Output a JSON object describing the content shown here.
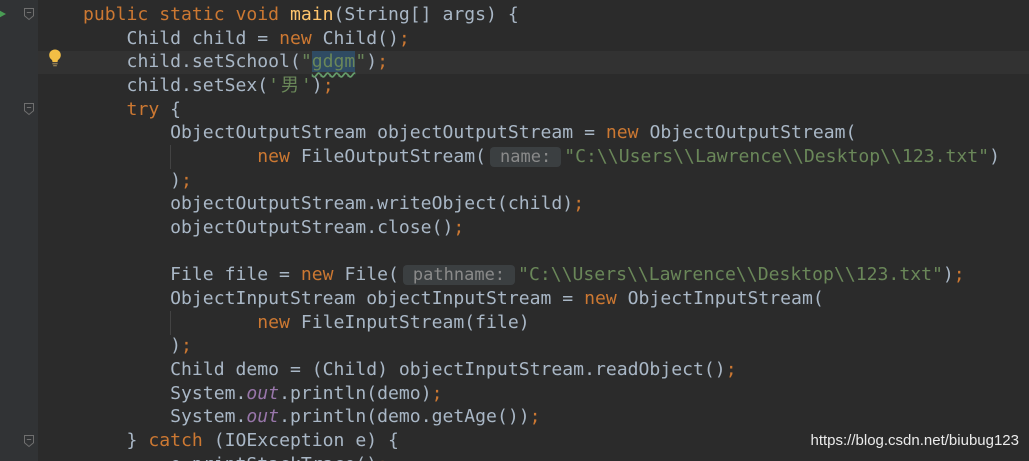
{
  "editor": {
    "lines": [
      {
        "indent": 4,
        "tokens": [
          {
            "type": "keyword",
            "text": "public static void "
          },
          {
            "type": "method-declaration",
            "text": "main"
          },
          {
            "type": "plain",
            "text": "(String[] args) {"
          }
        ]
      },
      {
        "indent": 8,
        "tokens": [
          {
            "type": "plain",
            "text": "Child child = "
          },
          {
            "type": "keyword",
            "text": "new"
          },
          {
            "type": "plain",
            "text": " Child()"
          },
          {
            "type": "punctuation",
            "text": ";"
          }
        ]
      },
      {
        "indent": 8,
        "tokens": [
          {
            "type": "plain",
            "text": "child.setSchool("
          },
          {
            "type": "string",
            "text": "\""
          },
          {
            "type": "string",
            "text": "gdgm",
            "typo": true,
            "selected": true
          },
          {
            "type": "string",
            "text": "\""
          },
          {
            "type": "plain",
            "text": ")"
          },
          {
            "type": "punctuation",
            "text": ";"
          }
        ]
      },
      {
        "indent": 8,
        "tokens": [
          {
            "type": "plain",
            "text": "child.setSex("
          },
          {
            "type": "string",
            "text": "'"
          },
          {
            "type": "string",
            "text": "男"
          },
          {
            "type": "string",
            "text": "'"
          },
          {
            "type": "plain",
            "text": ")"
          },
          {
            "type": "punctuation",
            "text": ";"
          }
        ]
      },
      {
        "indent": 8,
        "tokens": [
          {
            "type": "keyword",
            "text": "try"
          },
          {
            "type": "plain",
            "text": " {"
          }
        ]
      },
      {
        "indent": 12,
        "tokens": [
          {
            "type": "plain",
            "text": "ObjectOutputStream objectOutputStream = "
          },
          {
            "type": "keyword",
            "text": "new"
          },
          {
            "type": "plain",
            "text": " ObjectOutputStream("
          }
        ]
      },
      {
        "indent": 20,
        "tokens": [
          {
            "type": "keyword",
            "text": "new"
          },
          {
            "type": "plain",
            "text": " FileOutputStream("
          },
          {
            "type": "param-hint",
            "text": "name:"
          },
          {
            "type": "string",
            "text": "\"C:\\\\Users\\\\Lawrence\\\\Desktop\\\\123.txt\""
          },
          {
            "type": "plain",
            "text": ")"
          }
        ]
      },
      {
        "indent": 12,
        "tokens": [
          {
            "type": "plain",
            "text": ")"
          },
          {
            "type": "punctuation",
            "text": ";"
          }
        ]
      },
      {
        "indent": 12,
        "tokens": [
          {
            "type": "plain",
            "text": "objectOutputStream.writeObject(child)"
          },
          {
            "type": "punctuation",
            "text": ";"
          }
        ]
      },
      {
        "indent": 12,
        "tokens": [
          {
            "type": "plain",
            "text": "objectOutputStream.close()"
          },
          {
            "type": "punctuation",
            "text": ";"
          }
        ]
      },
      {
        "indent": 0,
        "tokens": []
      },
      {
        "indent": 12,
        "tokens": [
          {
            "type": "plain",
            "text": "File file = "
          },
          {
            "type": "keyword",
            "text": "new"
          },
          {
            "type": "plain",
            "text": " File("
          },
          {
            "type": "param-hint",
            "text": "pathname:"
          },
          {
            "type": "string",
            "text": "\"C:\\\\Users\\\\Lawrence\\\\Desktop\\\\123.txt\""
          },
          {
            "type": "plain",
            "text": ")"
          },
          {
            "type": "punctuation",
            "text": ";"
          }
        ]
      },
      {
        "indent": 12,
        "tokens": [
          {
            "type": "plain",
            "text": "ObjectInputStream objectInputStream = "
          },
          {
            "type": "keyword",
            "text": "new"
          },
          {
            "type": "plain",
            "text": " ObjectInputStream("
          }
        ]
      },
      {
        "indent": 20,
        "tokens": [
          {
            "type": "keyword",
            "text": "new"
          },
          {
            "type": "plain",
            "text": " FileInputStream(file)"
          }
        ]
      },
      {
        "indent": 12,
        "tokens": [
          {
            "type": "plain",
            "text": ")"
          },
          {
            "type": "punctuation",
            "text": ";"
          }
        ]
      },
      {
        "indent": 12,
        "tokens": [
          {
            "type": "plain",
            "text": "Child demo = (Child) objectInputStream.readObject()"
          },
          {
            "type": "punctuation",
            "text": ";"
          }
        ]
      },
      {
        "indent": 12,
        "tokens": [
          {
            "type": "plain",
            "text": "System."
          },
          {
            "type": "static-field",
            "text": "out"
          },
          {
            "type": "plain",
            "text": ".println(demo)"
          },
          {
            "type": "punctuation",
            "text": ";"
          }
        ]
      },
      {
        "indent": 12,
        "tokens": [
          {
            "type": "plain",
            "text": "System."
          },
          {
            "type": "static-field",
            "text": "out"
          },
          {
            "type": "plain",
            "text": ".println(demo.getAge())"
          },
          {
            "type": "punctuation",
            "text": ";"
          }
        ]
      },
      {
        "indent": 8,
        "tokens": [
          {
            "type": "plain",
            "text": "} "
          },
          {
            "type": "keyword",
            "text": "catch"
          },
          {
            "type": "plain",
            "text": " (IOException e) {"
          }
        ]
      },
      {
        "indent": 12,
        "tokens": [
          {
            "type": "plain",
            "text": "e.printStackTrace()"
          },
          {
            "type": "punctuation",
            "text": ";"
          }
        ]
      }
    ]
  },
  "icons": {
    "run": "run-icon",
    "fold": "fold-marker-icon",
    "intention": "lightbulb-icon"
  },
  "watermark": {
    "text": "https://blog.csdn.net/biubug123"
  },
  "theme": {
    "editor_background": "#2B2B2B",
    "gutter_background": "#313335",
    "current_line": "#323232",
    "plain": "#A9B7C6",
    "keyword": "#CC7832",
    "method_declaration": "#FFC66D",
    "string": "#6A8759",
    "static_field": "#9876AA",
    "param_hint_background": "#3B3F41",
    "param_hint_text": "#8A8A8A",
    "selection": "#2F4B63",
    "typo_underline": "#659C6B",
    "indent_guide": "#434343",
    "fold_marker": "#6F6F6F",
    "run_icon": "#499C54",
    "intention_bulb": "#F2BE45",
    "watermark": "#FFFFFF"
  }
}
